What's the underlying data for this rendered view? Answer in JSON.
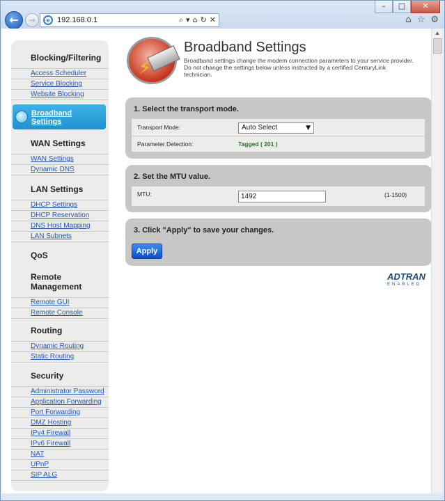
{
  "browser": {
    "url": "192.168.0.1",
    "window_buttons": [
      "–",
      "□",
      "✕"
    ],
    "address_icons": [
      "⌕",
      "▾",
      "⌂",
      "↻",
      "✕"
    ],
    "toolbar_icons": [
      "⌂",
      "☆",
      "⚙"
    ]
  },
  "sidebar": {
    "sections": [
      {
        "title": "Blocking/Filtering",
        "items": [
          "Access Scheduler",
          "Service Blocking",
          "Website Blocking"
        ]
      },
      {
        "title": "Broadband Settings",
        "items": []
      },
      {
        "title": "WAN Settings",
        "items": [
          "WAN Settings",
          "Dynamic DNS"
        ]
      },
      {
        "title": "LAN Settings",
        "items": [
          "DHCP Settings",
          "DHCP Reservation",
          "DNS Host Mapping",
          "LAN Subnets"
        ]
      },
      {
        "title": "QoS",
        "items": []
      },
      {
        "title": "Remote Management",
        "items": [
          "Remote GUI",
          "Remote Console"
        ]
      },
      {
        "title": "Routing",
        "items": [
          "Dynamic Routing",
          "Static Routing"
        ]
      },
      {
        "title": "Security",
        "items": [
          "Administrator Password",
          "Application Forwarding",
          "Port Forwarding",
          "DMZ Hosting",
          "IPv4 Firewall",
          "IPv6 Firewall",
          "NAT",
          "UPnP",
          "SIP ALG"
        ]
      }
    ],
    "active": {
      "line1": "Broadband",
      "line2": "Settings"
    },
    "remote_line1": "Remote",
    "remote_line2": "Management"
  },
  "header": {
    "title": "Broadband Settings",
    "description": "Broadband settings change the modem connection parameters to your service provider. Do not change the settings below unless instructed by a certified CenturyLink technician."
  },
  "step1": {
    "title": "1. Select the transport mode.",
    "transport_label": "Transport Mode:",
    "transport_value": "Auto Select",
    "param_label": "Parameter Detection:",
    "param_value": "Tagged ( 201 )"
  },
  "step2": {
    "title": "2. Set the MTU value.",
    "mtu_label": "MTU:",
    "mtu_value": "1492",
    "mtu_range": "(1-1500)"
  },
  "step3": {
    "title": "3. Click \"Apply\" to save your changes.",
    "apply_label": "Apply"
  },
  "brand": {
    "name": "ADTRAN",
    "sub": "ENABLED"
  }
}
